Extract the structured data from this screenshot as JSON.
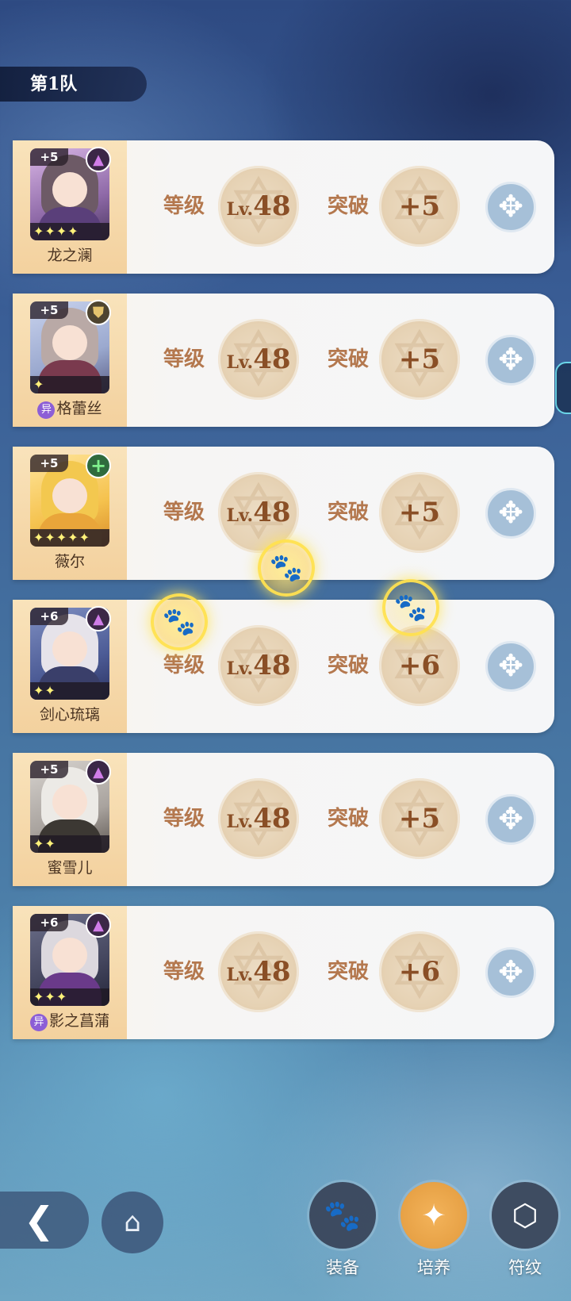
{
  "team": {
    "title": "第1队"
  },
  "labels": {
    "level": "等级",
    "breakthrough": "突破",
    "lv_prefix": "Lv."
  },
  "icons": {
    "move": "move-arrows-icon",
    "back": "back-arrow-icon",
    "home": "home-icon",
    "paw": "paw-icon"
  },
  "heroes": [
    {
      "name": "龙之澜",
      "plus": "+5",
      "class_icon": "upgrade-arrow-icon",
      "stars": "✦✦✦✦",
      "variant": false,
      "level": "48",
      "breakthrough": "+5"
    },
    {
      "name": "格蕾丝",
      "plus": "+5",
      "class_icon": "shield-icon",
      "stars": "✦",
      "variant": true,
      "variant_mark": "异",
      "level": "48",
      "breakthrough": "+5"
    },
    {
      "name": "薇尔",
      "plus": "+5",
      "class_icon": "heal-cross-icon",
      "stars": "✦✦✦✦✦",
      "variant": false,
      "level": "48",
      "breakthrough": "+5"
    },
    {
      "name": "剑心琉璃",
      "plus": "+6",
      "class_icon": "upgrade-arrow-icon",
      "stars": "✦✦",
      "variant": false,
      "level": "48",
      "breakthrough": "+6"
    },
    {
      "name": "蜜雪儿",
      "plus": "+5",
      "class_icon": "upgrade-arrow-icon",
      "stars": "✦✦",
      "variant": false,
      "level": "48",
      "breakthrough": "+5"
    },
    {
      "name": "影之菖蒲",
      "plus": "+6",
      "class_icon": "upgrade-arrow-icon",
      "stars": "✦✦✦",
      "variant": true,
      "variant_mark": "异",
      "level": "48",
      "breakthrough": "+6"
    }
  ],
  "bottom_nav": [
    {
      "label": "装备",
      "icon": "paw-coin-icon",
      "active": false
    },
    {
      "label": "培养",
      "icon": "card-star-icon",
      "active": true
    },
    {
      "label": "符纹",
      "icon": "rune-dice-icon",
      "active": false
    }
  ]
}
